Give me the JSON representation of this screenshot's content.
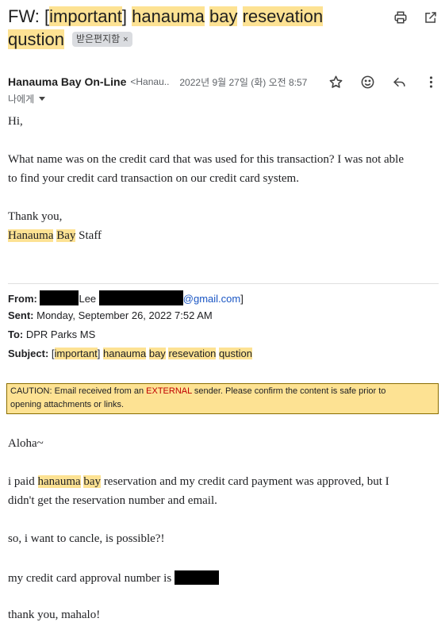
{
  "subject": {
    "prefix": "FW: [",
    "w_important": "important",
    "bracket_close": "]",
    "w_hanauma": "hanauma",
    "w_bay": "bay",
    "w_resevation": "resevation",
    "w_qustion": "qustion",
    "label": "받은편지함",
    "label_close": "×"
  },
  "icons": [
    "print-icon",
    "open-new-window-icon",
    "star-icon",
    "emoji-icon",
    "reply-icon",
    "more-vert-icon"
  ],
  "sender": {
    "name": "Hanauma Bay On-Line",
    "email_trunc": "<Hanau...",
    "date": "2022년 9월 27일 (화) 오전 8:57",
    "to_me": "나에게"
  },
  "body1": {
    "greeting": "Hi,",
    "p1_line1": "What name was on the credit card that was used for this transaction?  I was not able",
    "p1_line2": "to find your credit card transaction on our credit card system.",
    "thanks": "Thank you,",
    "sig_hanauma": "Hanauma",
    "sig_bay": "Bay",
    "sig_staff": "Staff"
  },
  "forward": {
    "from_label": "From:",
    "from_lee": "Lee",
    "from_domain": "@gmail.com",
    "from_bracket": "]",
    "sent_label": "Sent:",
    "sent_value": "Monday, September 26, 2022 7:52 AM",
    "to_label": "To:",
    "to_value": "DPR Parks MS",
    "subject_label": "Subject:",
    "subj_open": "[",
    "subj_important": "important",
    "subj_close": "]",
    "subj_hanauma": "hanauma",
    "subj_bay": "bay",
    "subj_resevation": "resevation",
    "subj_qustion": "qustion"
  },
  "caution": {
    "lead": "CAUTION:    Email received from an ",
    "external": "EXTERNAL",
    "tail": " sender.    Please confirm the content is safe prior to",
    "line2": "opening attachments or links."
  },
  "body2": {
    "aloha": "Aloha~",
    "p1_pre": "i paid ",
    "p1_hanauma": "hanauma",
    "p1_bay": "bay",
    "p1_post": " reservation and my credit card payment was approved, but I",
    "p1_line2": "didn't get the reservation number and email.",
    "p2": "so, i want to cancle, is possible?!",
    "p3": "my credit card approval number is ",
    "p4": "thank you, mahalo!"
  }
}
